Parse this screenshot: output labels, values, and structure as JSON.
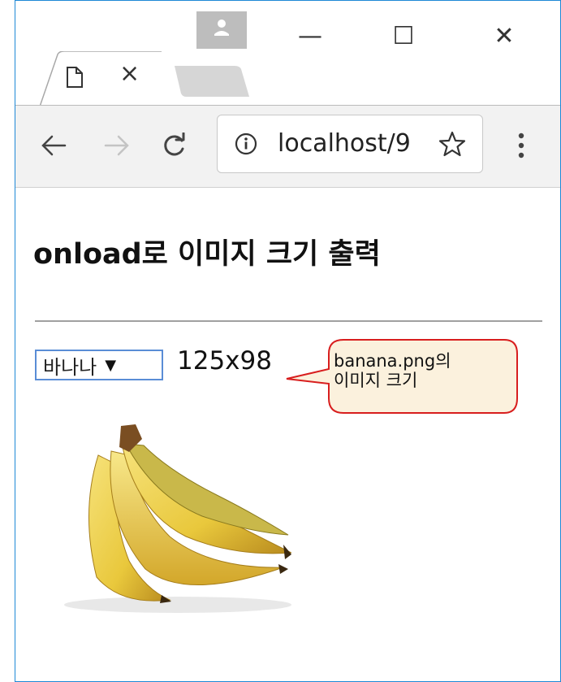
{
  "browser": {
    "tab_close_glyph": "×",
    "address": "localhost/9",
    "window_controls": {
      "minimize": "—",
      "maximize": "☐",
      "close": "✕"
    }
  },
  "page": {
    "title": "onload로 이미지 크기 출력",
    "select": {
      "selected": "바나나",
      "arrow": "▼"
    },
    "size_text": "125x98",
    "callout_lines": [
      "banana.png의",
      "이미지 크기"
    ]
  },
  "colors": {
    "frame_border": "#1e88d6",
    "callout_border": "#d81e1e",
    "callout_fill": "#fbf1dd",
    "toolbar_bg": "#f2f2f2",
    "select_border": "#5a8dd6"
  }
}
